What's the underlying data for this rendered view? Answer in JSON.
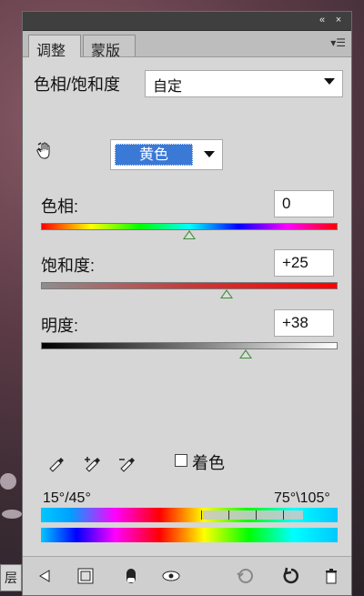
{
  "panel": {
    "tabs": [
      {
        "label": "调整"
      },
      {
        "label": "蒙版"
      }
    ],
    "adjustment": {
      "label": "色相/饱和度",
      "preset": "自定"
    },
    "channel": {
      "value": "黄色"
    },
    "hue": {
      "label": "色相:",
      "value": "0",
      "slider_fraction": 0.5
    },
    "saturation": {
      "label": "饱和度:",
      "value": "+25",
      "slider_fraction": 0.625
    },
    "lightness": {
      "label": "明度:",
      "value": "+38",
      "slider_fraction": 0.69
    },
    "colorize": {
      "label": "着色",
      "checked": false
    },
    "range": {
      "left": "15°/45°",
      "right": "75°\\105°"
    },
    "side_label": "层"
  },
  "icons": {
    "top": [
      "collapse-icon",
      "close-icon"
    ],
    "bottom": [
      "back-icon",
      "clip-icon",
      "mask-icon",
      "visibility-icon",
      "previous-state-icon",
      "reset-icon",
      "delete-icon"
    ]
  },
  "colors": {
    "accent": "#3b79d6",
    "panel": "#d6d6d6"
  }
}
